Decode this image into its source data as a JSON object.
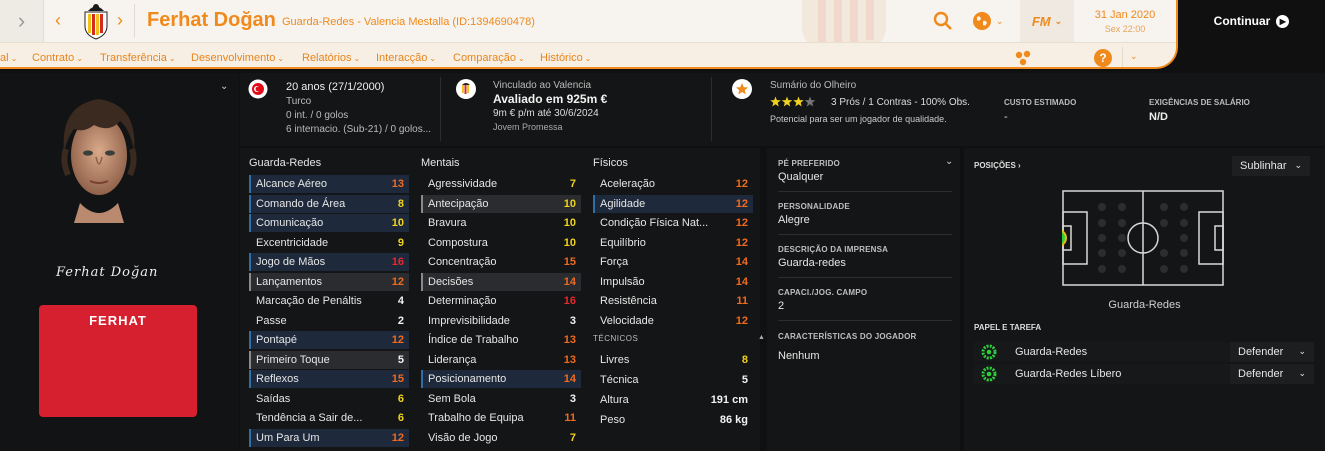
{
  "header": {
    "player_name": "Ferhat Doğan",
    "player_subtitle": "Guarda-Redes - Valencia Mestalla (ID:1394690478)",
    "date": "31 Jan 2020",
    "day_time": "Sex 22:00",
    "fm_label": "FM",
    "continue_label": "Continuar"
  },
  "menu": [
    {
      "label": "al"
    },
    {
      "label": "Contrato"
    },
    {
      "label": "Transferência"
    },
    {
      "label": "Desenvolvimento"
    },
    {
      "label": "Relatórios"
    },
    {
      "label": "Interacção"
    },
    {
      "label": "Comparação"
    },
    {
      "label": "Histórico"
    }
  ],
  "profile": {
    "signature": "Ferhat Doğan",
    "shirt_name": "FERHAT"
  },
  "info": {
    "age": "20 anos (27/1/2000)",
    "nationality": "Turco",
    "caps": "0 int. / 0 golos",
    "youth_caps": "6 internacio. (Sub-21) / 0 golos...",
    "contract": "Vinculado ao Valencia",
    "value": "Avaliado em 925m €",
    "wage": "9m € p/m até 30/6/2024",
    "status": "Jovem Promessa",
    "scout_title": "Sumário do Olheiro",
    "scout_summary": "3 Prós / 1 Contras - 100% Obs.",
    "scout_potential": "Potencial para ser um jogador de qualidade.",
    "cost_label": "CUSTO ESTIMADO",
    "cost_value": "-",
    "wage_req_label": "EXIGÊNCIAS DE SALÁRIO",
    "wage_req_value": "N/D",
    "stars_filled": 3,
    "stars_total": 4
  },
  "attributes": {
    "gk_title": "Guarda-Redes",
    "mental_title": "Mentais",
    "physical_title": "Físicos",
    "technical_title": "TÉCNICOS",
    "gk": [
      {
        "name": "Alcance Aéreo",
        "value": "13",
        "color": "#f06a1f",
        "hl": "blue"
      },
      {
        "name": "Comando de Área",
        "value": "8",
        "color": "#f0d21f",
        "hl": "blue"
      },
      {
        "name": "Comunicação",
        "value": "10",
        "color": "#f0d21f",
        "hl": "blue"
      },
      {
        "name": "Excentricidade",
        "value": "9",
        "color": "#f0d21f",
        "hl": ""
      },
      {
        "name": "Jogo de Mãos",
        "value": "16",
        "color": "#e8262c",
        "hl": "blue"
      },
      {
        "name": "Lançamentos",
        "value": "12",
        "color": "#f06a1f",
        "hl": "grey"
      },
      {
        "name": "Marcação de Penáltis",
        "value": "4",
        "color": "#f2f2f2",
        "hl": ""
      },
      {
        "name": "Passe",
        "value": "2",
        "color": "#f2f2f2",
        "hl": ""
      },
      {
        "name": "Pontapé",
        "value": "12",
        "color": "#f06a1f",
        "hl": "blue"
      },
      {
        "name": "Primeiro Toque",
        "value": "5",
        "color": "#f2f2f2",
        "hl": "grey"
      },
      {
        "name": "Reflexos",
        "value": "15",
        "color": "#f06a1f",
        "hl": "blue"
      },
      {
        "name": "Saídas",
        "value": "6",
        "color": "#f0d21f",
        "hl": ""
      },
      {
        "name": "Tendência a Sair de...",
        "value": "6",
        "color": "#f0d21f",
        "hl": ""
      },
      {
        "name": "Um Para Um",
        "value": "12",
        "color": "#f06a1f",
        "hl": "blue"
      }
    ],
    "mental": [
      {
        "name": "Agressividade",
        "value": "7",
        "color": "#f0d21f",
        "hl": ""
      },
      {
        "name": "Antecipação",
        "value": "10",
        "color": "#f0d21f",
        "hl": "grey"
      },
      {
        "name": "Bravura",
        "value": "10",
        "color": "#f0d21f",
        "hl": ""
      },
      {
        "name": "Compostura",
        "value": "10",
        "color": "#f0d21f",
        "hl": ""
      },
      {
        "name": "Concentração",
        "value": "15",
        "color": "#f06a1f",
        "hl": ""
      },
      {
        "name": "Decisões",
        "value": "14",
        "color": "#f06a1f",
        "hl": "grey"
      },
      {
        "name": "Determinação",
        "value": "16",
        "color": "#e8262c",
        "hl": ""
      },
      {
        "name": "Imprevisibilidade",
        "value": "3",
        "color": "#f2f2f2",
        "hl": ""
      },
      {
        "name": "Índice de Trabalho",
        "value": "13",
        "color": "#f06a1f",
        "hl": ""
      },
      {
        "name": "Liderança",
        "value": "13",
        "color": "#f06a1f",
        "hl": ""
      },
      {
        "name": "Posicionamento",
        "value": "14",
        "color": "#f06a1f",
        "hl": "blue"
      },
      {
        "name": "Sem Bola",
        "value": "3",
        "color": "#f2f2f2",
        "hl": ""
      },
      {
        "name": "Trabalho de Equipa",
        "value": "11",
        "color": "#f06a1f",
        "hl": ""
      },
      {
        "name": "Visão de Jogo",
        "value": "7",
        "color": "#f0d21f",
        "hl": ""
      }
    ],
    "physical": [
      {
        "name": "Aceleração",
        "value": "12",
        "color": "#f06a1f",
        "hl": ""
      },
      {
        "name": "Agilidade",
        "value": "12",
        "color": "#f06a1f",
        "hl": "blue"
      },
      {
        "name": "Condição Física Nat...",
        "value": "12",
        "color": "#f06a1f",
        "hl": ""
      },
      {
        "name": "Equilíbrio",
        "value": "12",
        "color": "#f06a1f",
        "hl": ""
      },
      {
        "name": "Força",
        "value": "14",
        "color": "#f06a1f",
        "hl": ""
      },
      {
        "name": "Impulsão",
        "value": "14",
        "color": "#f06a1f",
        "hl": ""
      },
      {
        "name": "Resistência",
        "value": "11",
        "color": "#f06a1f",
        "hl": ""
      },
      {
        "name": "Velocidade",
        "value": "12",
        "color": "#f06a1f",
        "hl": ""
      }
    ],
    "technical": [
      {
        "name": "Livres",
        "value": "8",
        "color": "#f0d21f",
        "hl": ""
      },
      {
        "name": "Técnica",
        "value": "5",
        "color": "#f2f2f2",
        "hl": ""
      }
    ],
    "body": [
      {
        "name": "Altura",
        "value": "191 cm",
        "color": "#f2f2f2",
        "hl": ""
      },
      {
        "name": "Peso",
        "value": "86 kg",
        "color": "#f2f2f2",
        "hl": ""
      }
    ]
  },
  "details": {
    "foot_label": "PÉ PREFERIDO",
    "foot_value": "Qualquer",
    "personality_label": "PERSONALIDADE",
    "personality_value": "Alegre",
    "press_label": "DESCRIÇÃO DA IMPRENSA",
    "press_value": "Guarda-redes",
    "ability_label": "CAPACI./JOG. CAMPO",
    "ability_value": "2",
    "traits_label": "CARACTERÍSTICAS DO JOGADOR",
    "traits_value": "Nenhum"
  },
  "positions": {
    "title": "POSIÇÕES",
    "highlight_label": "Sublinhar",
    "position_name": "Guarda-Redes",
    "role_title": "PAPEL E TAREFA",
    "roles": [
      {
        "name": "Guarda-Redes",
        "duty": "Defender"
      },
      {
        "name": "Guarda-Redes Líbero",
        "duty": "Defender"
      }
    ]
  },
  "colors": {
    "accent": "#f08a1c",
    "very_good": "#e8262c",
    "good": "#f06a1f",
    "average": "#f0d21f",
    "low": "#f2f2f2"
  }
}
